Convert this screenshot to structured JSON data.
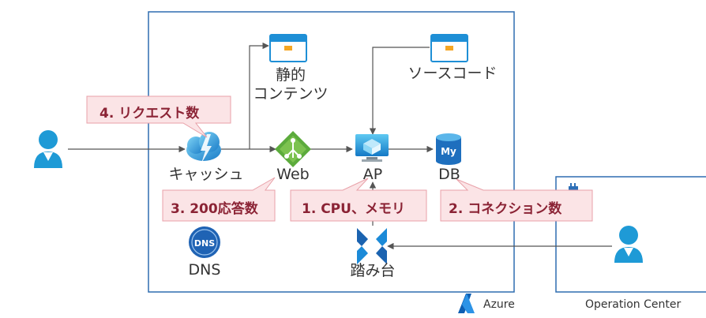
{
  "nodes": {
    "static_content": "静的\nコンテンツ",
    "source_code": "ソースコード",
    "cache": "キャッシュ",
    "web": "Web",
    "ap": "AP",
    "db": "DB",
    "dns": "DNS",
    "bastion": "踏み台"
  },
  "icon_text": {
    "db_icon": "My",
    "dns_icon": "DNS"
  },
  "callouts": {
    "request_count": "4. リクエスト数",
    "status_200_count": "3. 200応答数",
    "cpu_memory": "1. CPU、メモリ",
    "connection_count": "2. コネクション数"
  },
  "regions": {
    "azure": "Azure",
    "operation_center": "Operation Center"
  },
  "colors": {
    "azure_border": "#2f6db0",
    "callout_fill": "#fbe4e6",
    "callout_border": "#e8a0a8",
    "callout_text": "#8b2335",
    "user_blue": "#1e9ad6",
    "arrow": "#555555"
  }
}
